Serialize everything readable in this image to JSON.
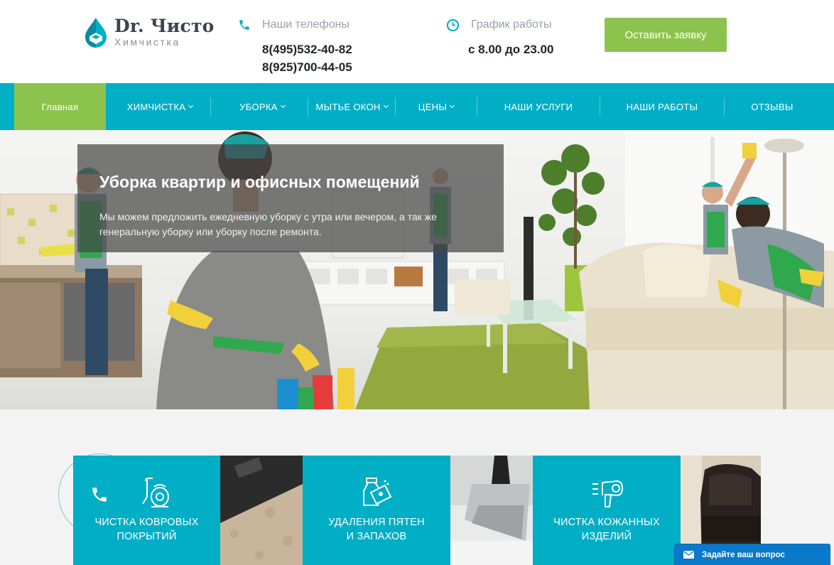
{
  "brand": {
    "name": "Dr. Чисто",
    "tagline": "Химчистка",
    "drop_color": "#00aec6"
  },
  "contacts": {
    "phones_label": "Наши телефоны",
    "phone_1": "8(495)532-40-82",
    "phone_2": "8(925)700-44-05",
    "hours_label": "График работы",
    "hours_value": "с 8.00 до 23.00",
    "phone_icon": "phone-icon",
    "clock_icon": "clock-icon"
  },
  "cta": {
    "label": "Оставить заявку"
  },
  "nav": {
    "items": [
      {
        "label": "Главная",
        "active": true,
        "dropdown": false
      },
      {
        "label": "ХИМЧИСТКА",
        "dropdown": true
      },
      {
        "label": "УБОРКА",
        "dropdown": true
      },
      {
        "label": "МЫТЬЕ ОКОН",
        "dropdown": true
      },
      {
        "label": "ЦЕНЫ",
        "dropdown": true
      },
      {
        "label": "НАШИ УСЛУГИ",
        "dropdown": false
      },
      {
        "label": "НАШИ РАБОТЫ",
        "dropdown": false
      },
      {
        "label": "ОТЗЫВЫ",
        "dropdown": false
      }
    ]
  },
  "hero": {
    "title": "Уборка квартир и офисных помещений",
    "text": "Мы можем предложить ежедневную уборку с утра или вечером, а так же генеральную уборку или уборку после ремонта."
  },
  "services": [
    {
      "label_line1": "ЧИСТКА КОВРОВЫХ",
      "label_line2": "ПОКРЫТИЙ",
      "icon": "vacuum-cleaner-icon"
    },
    {
      "label_line1": "УДАЛЕНИЯ ПЯТЕН",
      "label_line2": "И ЗАПАХОВ",
      "icon": "spray-cleaning-icon"
    },
    {
      "label_line1": "ЧИСТКА КОЖАННЫХ",
      "label_line2": "ИЗДЕЛИЙ",
      "icon": "hair-dryer-icon"
    }
  ],
  "widgets": {
    "ask_label": "Задайте ваш вопрос",
    "call_icon": "phone-icon"
  },
  "colors": {
    "accent": "#00aec6",
    "green": "#8cc34d",
    "widget_blue": "#0a79c9"
  }
}
